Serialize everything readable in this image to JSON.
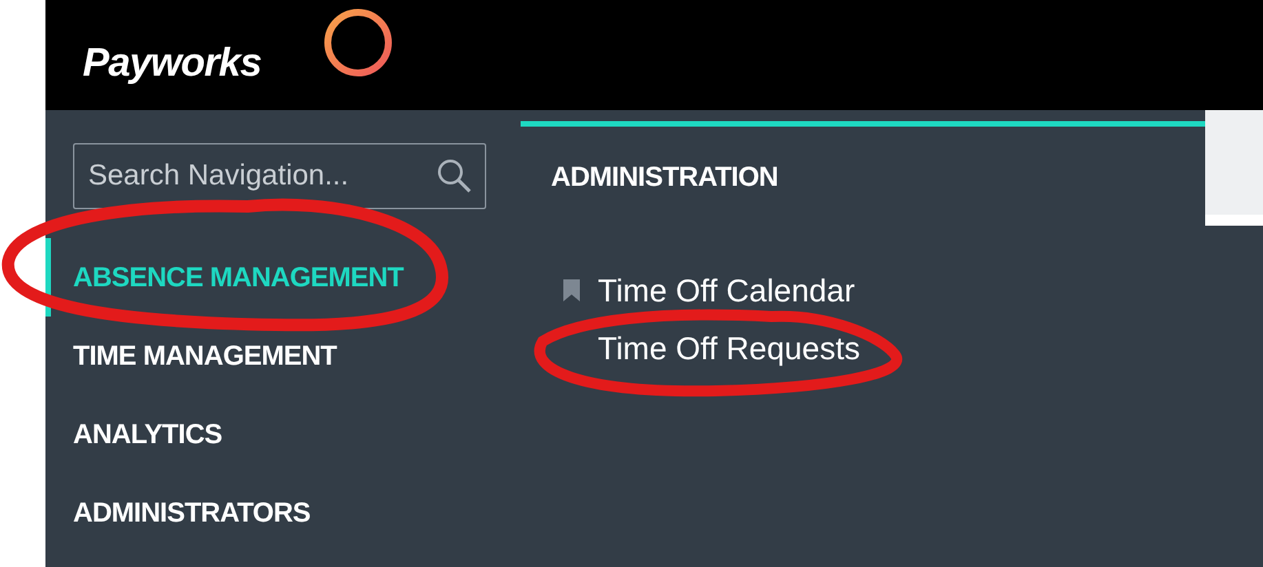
{
  "header": {
    "logo": "Payworks"
  },
  "search": {
    "placeholder": "Search Navigation..."
  },
  "nav_items": [
    {
      "label": "ABSENCE MANAGEMENT",
      "selected": true
    },
    {
      "label": "TIME MANAGEMENT",
      "selected": false
    },
    {
      "label": "ANALYTICS",
      "selected": false
    },
    {
      "label": "ADMINISTRATORS",
      "selected": false
    }
  ],
  "submenu": {
    "heading": "ADMINISTRATION",
    "items": [
      {
        "label": "Time Off Calendar",
        "bookmarked": true
      },
      {
        "label": "Time Off Requests",
        "bookmarked": false
      }
    ]
  }
}
